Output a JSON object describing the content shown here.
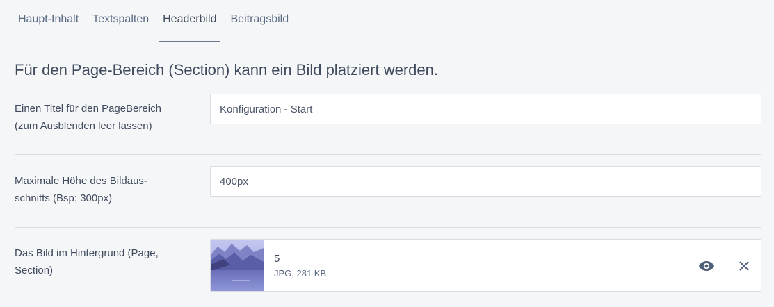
{
  "tabs": [
    {
      "label": "Haupt-Inhalt",
      "active": false
    },
    {
      "label": "Textspalten",
      "active": false
    },
    {
      "label": "Headerbild",
      "active": true
    },
    {
      "label": "Beitragsbild",
      "active": false
    }
  ],
  "heading": "Für den Page-Bereich (Section) kann ein Bild platziert werden.",
  "fields": {
    "title": {
      "label_line1": "Einen Titel für den PageBereich",
      "label_line2": "(zum Ausblenden leer lassen)",
      "value": "Konfiguration - Start"
    },
    "height": {
      "label_line1": "Maximale Höhe des Bildaus-",
      "label_line2": "schnitts (Bsp: 300px)",
      "value": "400px"
    },
    "image": {
      "label_line1": "Das Bild im Hintergrund (Page,",
      "label_line2": "Section)",
      "file_name": "5",
      "file_meta": "JPG, 281 KB"
    }
  },
  "icons": {
    "preview": "eye-icon",
    "remove": "close-icon"
  },
  "colors": {
    "background": "#f5f6f8",
    "text": "#3f4a5c",
    "icon": "#4e5f7a",
    "border": "#d9dde3"
  }
}
